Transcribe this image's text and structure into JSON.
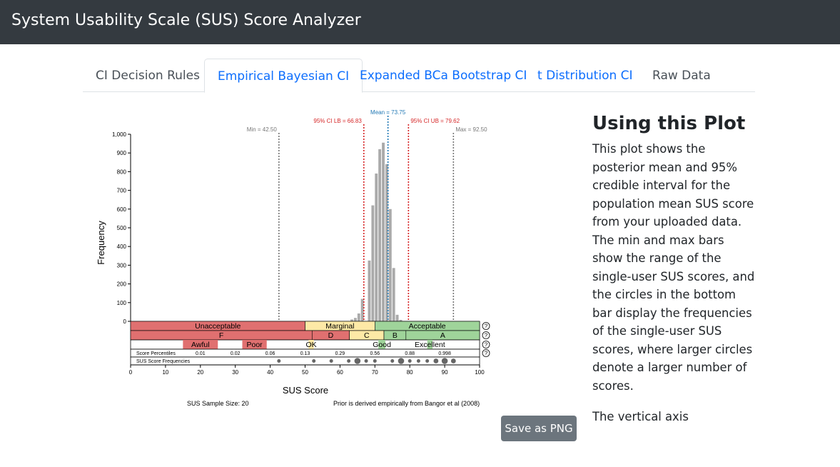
{
  "app": {
    "title": "System Usability Scale (SUS) Score Analyzer"
  },
  "tabs": [
    {
      "label": "CI Decision Rules",
      "state": "plain"
    },
    {
      "label": "Empirical Bayesian CI",
      "state": "active"
    },
    {
      "label": "Expanded BCa Bootstrap CI",
      "state": "link"
    },
    {
      "label": "t Distribution CI",
      "state": "link"
    },
    {
      "label": "Raw Data",
      "state": "plain"
    }
  ],
  "sidebar": {
    "heading": "Using this Plot",
    "paragraph": "This plot shows the posterior mean and 95% credible interval for the population mean SUS score from your uploaded data. The min and max bars show the range of the single-user SUS scores, and the circles in the bottom bar display the frequencies of the single-user SUS scores, where larger circles denote a larger number of scores.",
    "overflow_text": "The vertical axis"
  },
  "save_button": {
    "label": "Save as PNG"
  },
  "colors": {
    "red": "#e07070",
    "yellow": "#fde9a6",
    "green": "#9fd49a",
    "bar": "#aaaaaa",
    "ci": "#d62728",
    "mean": "#1f77b4",
    "range": "#777777"
  },
  "chart_data": {
    "type": "bar",
    "xlabel": "SUS Score",
    "ylabel": "Frequency",
    "xlim": [
      0,
      100
    ],
    "ylim": [
      0,
      1000
    ],
    "xticks": [
      "0",
      "10",
      "20",
      "30",
      "40",
      "50",
      "60",
      "70",
      "80",
      "90",
      "100"
    ],
    "yticks": [
      "0",
      "100",
      "200",
      "300",
      "400",
      "500",
      "600",
      "700",
      "800",
      "900",
      "1,000"
    ],
    "bins": [
      {
        "x0": 63,
        "x1": 64,
        "value": 10
      },
      {
        "x0": 64,
        "x1": 65,
        "value": 18
      },
      {
        "x0": 65,
        "x1": 66,
        "value": 42
      },
      {
        "x0": 66,
        "x1": 67,
        "value": 120
      },
      {
        "x0": 68,
        "x1": 69,
        "value": 325
      },
      {
        "x0": 69,
        "x1": 70,
        "value": 620
      },
      {
        "x0": 70,
        "x1": 71,
        "value": 790
      },
      {
        "x0": 71,
        "x1": 72,
        "value": 920
      },
      {
        "x0": 72,
        "x1": 73,
        "value": 955
      },
      {
        "x0": 73,
        "x1": 74,
        "value": 840
      },
      {
        "x0": 74,
        "x1": 75,
        "value": 600
      },
      {
        "x0": 75,
        "x1": 76,
        "value": 285
      },
      {
        "x0": 76,
        "x1": 77,
        "value": 35
      },
      {
        "x0": 77,
        "x1": 78,
        "value": 8
      }
    ],
    "markers": [
      {
        "label": "Min = 42.50",
        "value": 42.5,
        "kind": "range"
      },
      {
        "label": "95% CI LB = 66.83",
        "value": 66.83,
        "kind": "ci"
      },
      {
        "label": "Mean = 73.75",
        "value": 73.75,
        "kind": "mean"
      },
      {
        "label": "95% CI UB = 79.62",
        "value": 79.62,
        "kind": "ci"
      },
      {
        "label": "Max = 92.50",
        "value": 92.5,
        "kind": "range"
      }
    ],
    "acceptability": [
      {
        "label": "Unacceptable",
        "from": 0,
        "to": 50,
        "color": "red"
      },
      {
        "label": "Marginal",
        "from": 50,
        "to": 70,
        "color": "yellow"
      },
      {
        "label": "Acceptable",
        "from": 70,
        "to": 100,
        "color": "green"
      }
    ],
    "grades": [
      {
        "label": "F",
        "from": 0,
        "to": 52,
        "color": "red"
      },
      {
        "label": "D",
        "from": 52,
        "to": 62.7,
        "color": "red"
      },
      {
        "label": "C",
        "from": 62.7,
        "to": 72.6,
        "color": "yellow"
      },
      {
        "label": "B",
        "from": 72.6,
        "to": 78.9,
        "color": "green"
      },
      {
        "label": "A",
        "from": 78.9,
        "to": 100,
        "color": "green"
      }
    ],
    "adjectives": [
      {
        "label": "Awful",
        "from": 15,
        "to": 25,
        "color": "red"
      },
      {
        "label": "Poor",
        "from": 32,
        "to": 39,
        "color": "red"
      },
      {
        "label": "OK",
        "from": 51,
        "to": 52.5,
        "color": "yellow"
      },
      {
        "label": "Good",
        "from": 71,
        "to": 73,
        "color": "green"
      },
      {
        "label": "Excellent",
        "from": 85,
        "to": 86.5,
        "color": "green"
      }
    ],
    "percentiles_label": "Score Percentiles",
    "percentiles": [
      {
        "label": "0.01",
        "x": 20
      },
      {
        "label": "0.02",
        "x": 30
      },
      {
        "label": "0.06",
        "x": 40
      },
      {
        "label": "0.13",
        "x": 50
      },
      {
        "label": "0.29",
        "x": 60
      },
      {
        "label": "0.56",
        "x": 70
      },
      {
        "label": "0.88",
        "x": 80
      },
      {
        "label": "0.998",
        "x": 90
      }
    ],
    "frequencies_label": "SUS Score Frequencies",
    "score_frequencies": [
      {
        "x": 42.5,
        "count": 1
      },
      {
        "x": 52.5,
        "count": 1
      },
      {
        "x": 57.5,
        "count": 1
      },
      {
        "x": 62.5,
        "count": 1
      },
      {
        "x": 65,
        "count": 3
      },
      {
        "x": 67.5,
        "count": 1
      },
      {
        "x": 70,
        "count": 1
      },
      {
        "x": 75,
        "count": 1
      },
      {
        "x": 77.5,
        "count": 3
      },
      {
        "x": 80,
        "count": 1
      },
      {
        "x": 82.5,
        "count": 1
      },
      {
        "x": 85,
        "count": 1
      },
      {
        "x": 87.5,
        "count": 2
      },
      {
        "x": 90,
        "count": 3
      },
      {
        "x": 92.5,
        "count": 2
      }
    ],
    "help_icon": "?",
    "sample_size": "SUS Sample Size: 20",
    "prior_note": "Prior is derived empirically from Bangor et al (2008)"
  }
}
